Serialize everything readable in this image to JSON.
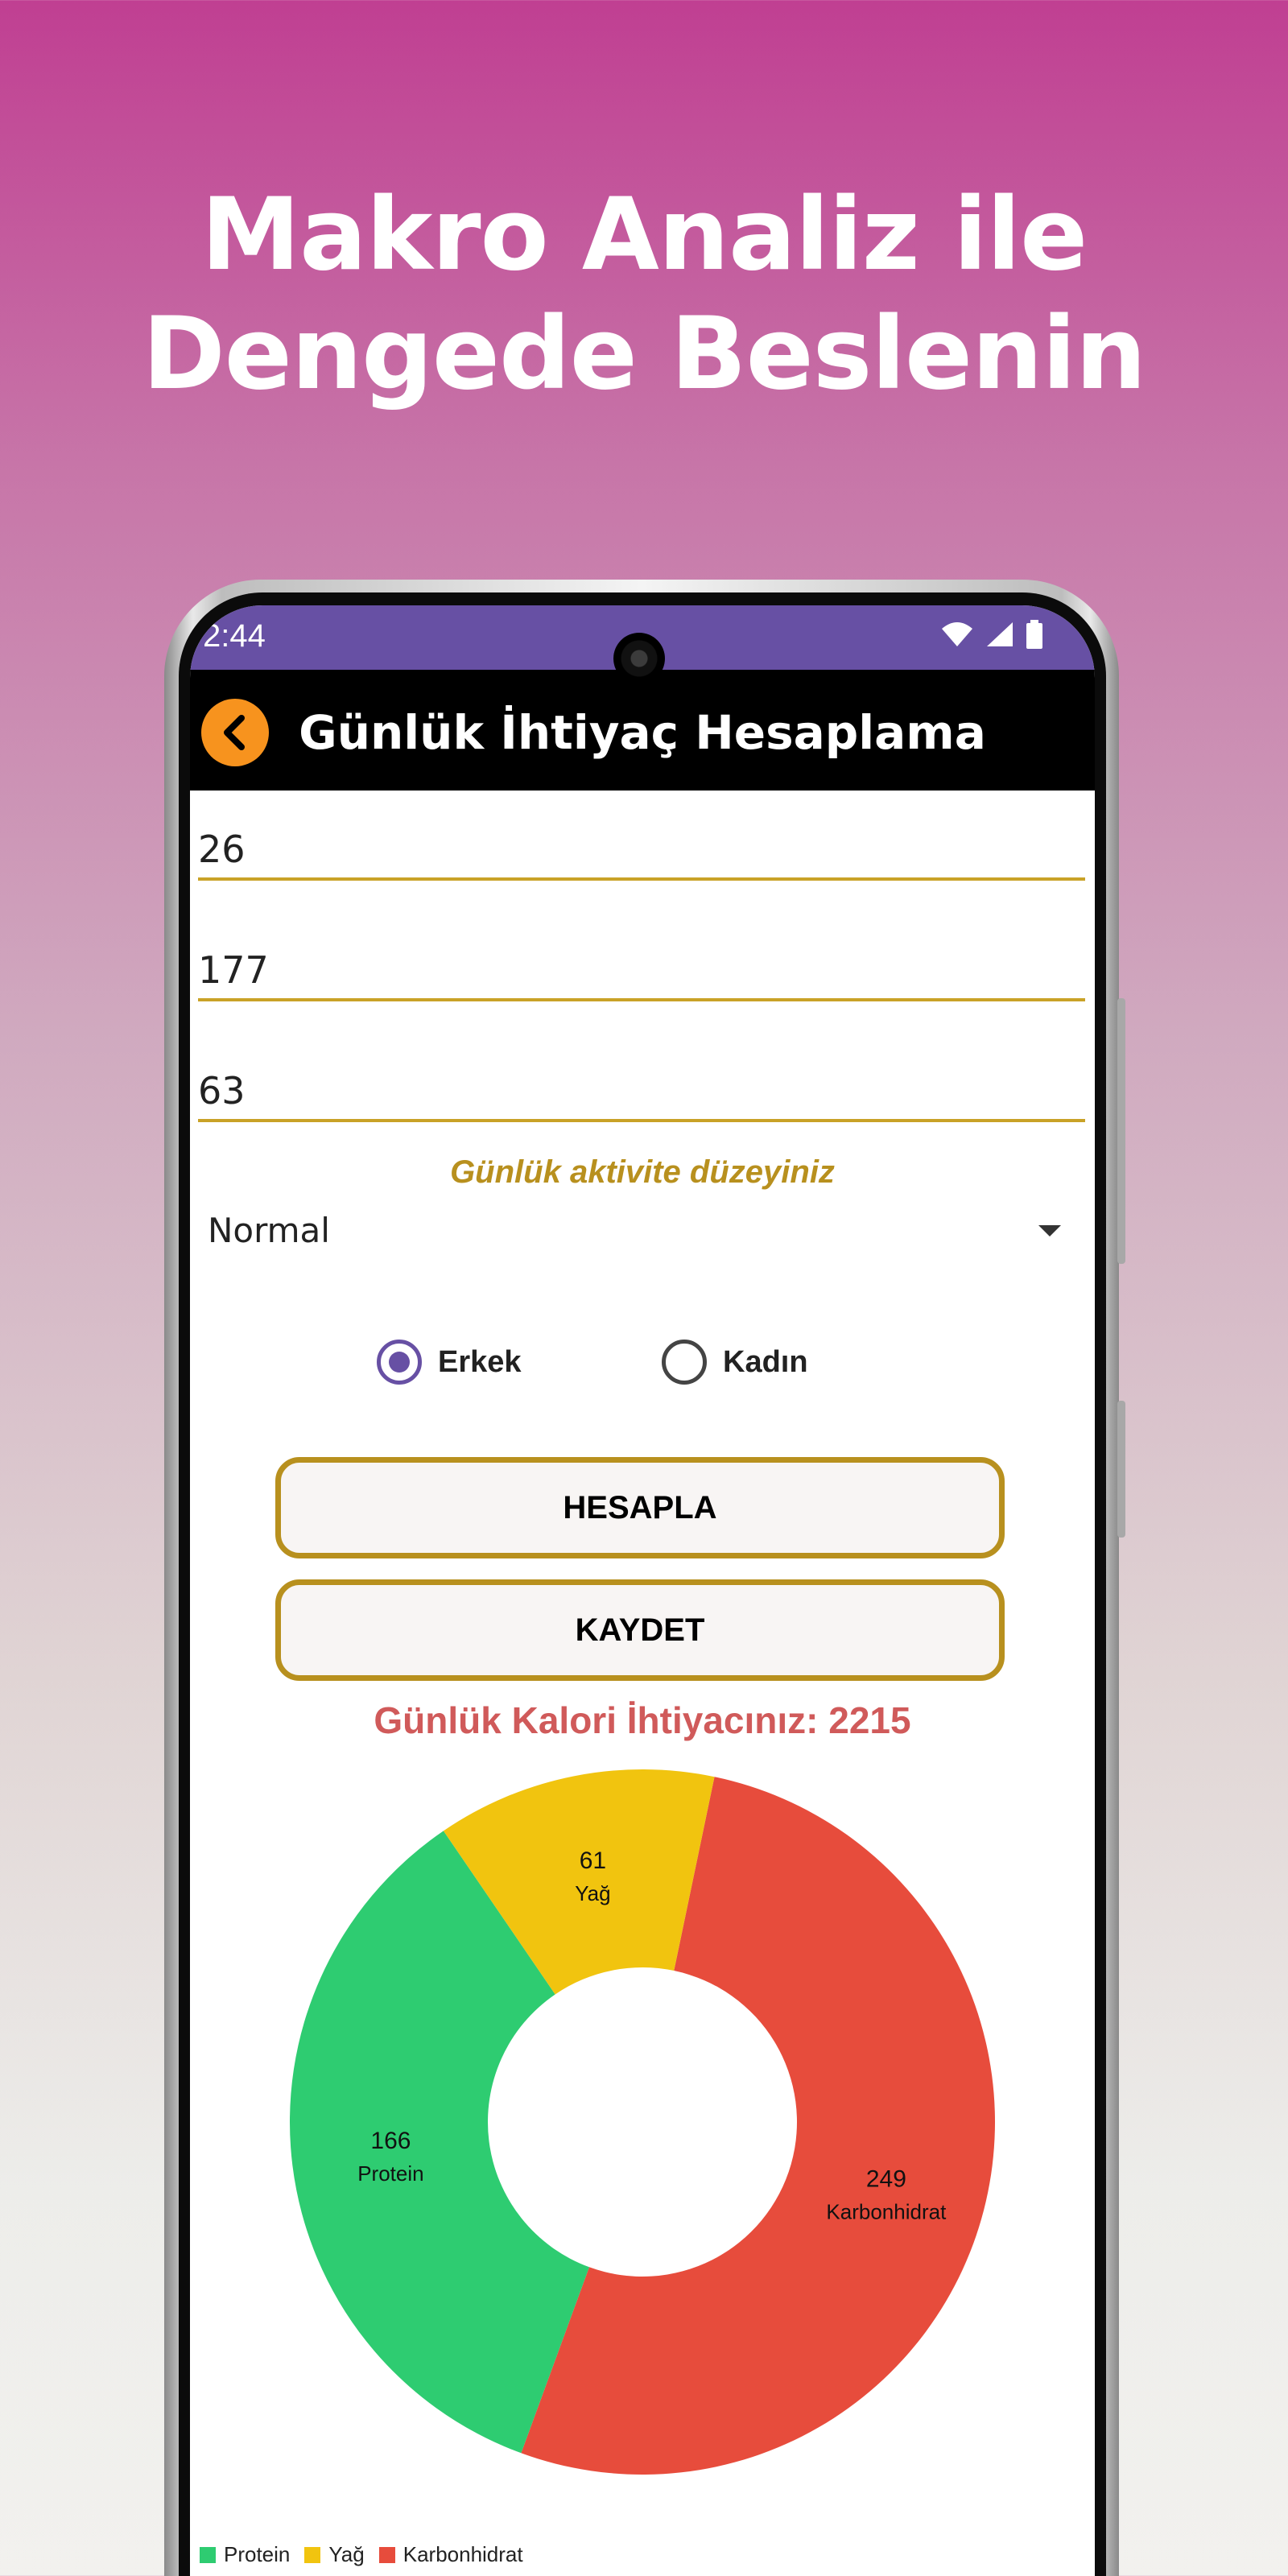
{
  "headline": {
    "line1": "Makro Analiz ile",
    "line2": "Dengede Beslenin"
  },
  "status": {
    "time": "2:44"
  },
  "appbar": {
    "title": "Günlük İhtiyaç Hesaplama"
  },
  "form": {
    "age_value": "26",
    "height_value": "177",
    "weight_value": "63",
    "activity_label": "Günlük aktivite düzeyiniz",
    "activity_selected": "Normal",
    "gender": {
      "male": "Erkek",
      "female": "Kadın",
      "selected": "male"
    },
    "calculate_label": "HESAPLA",
    "save_label": "KAYDET"
  },
  "result": {
    "kcal_text": "Günlük Kalori İhtiyacınız: 2215"
  },
  "colors": {
    "protein": "#2ecc71",
    "fat": "#f1c40f",
    "carb": "#e74c3c",
    "accent": "#b8901e",
    "status": "#6750a4"
  },
  "chart_data": {
    "type": "pie",
    "donut": true,
    "slices": [
      {
        "label": "Protein",
        "value": 166,
        "color": "#2ecc71"
      },
      {
        "label": "Yağ",
        "value": 61,
        "color": "#f1c40f"
      },
      {
        "label": "Karbonhidrat",
        "value": 249,
        "color": "#e74c3c"
      }
    ],
    "legend": [
      "Protein",
      "Yağ",
      "Karbonhidrat"
    ],
    "legend_position": "bottom-left"
  }
}
